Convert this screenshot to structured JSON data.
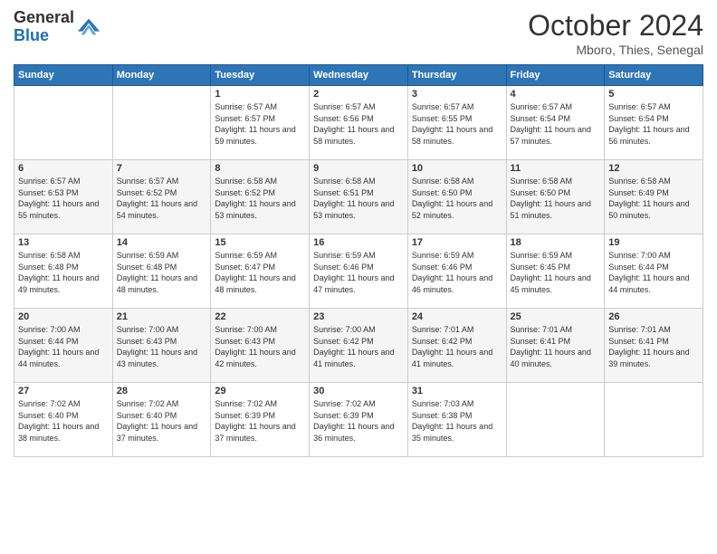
{
  "header": {
    "logo": {
      "line1": "General",
      "line2": "Blue"
    },
    "title": "October 2024",
    "subtitle": "Mboro, Thies, Senegal"
  },
  "days_of_week": [
    "Sunday",
    "Monday",
    "Tuesday",
    "Wednesday",
    "Thursday",
    "Friday",
    "Saturday"
  ],
  "weeks": [
    [
      {
        "day": "",
        "sunrise": "",
        "sunset": "",
        "daylight": ""
      },
      {
        "day": "",
        "sunrise": "",
        "sunset": "",
        "daylight": ""
      },
      {
        "day": "1",
        "sunrise": "Sunrise: 6:57 AM",
        "sunset": "Sunset: 6:57 PM",
        "daylight": "Daylight: 11 hours and 59 minutes."
      },
      {
        "day": "2",
        "sunrise": "Sunrise: 6:57 AM",
        "sunset": "Sunset: 6:56 PM",
        "daylight": "Daylight: 11 hours and 58 minutes."
      },
      {
        "day": "3",
        "sunrise": "Sunrise: 6:57 AM",
        "sunset": "Sunset: 6:55 PM",
        "daylight": "Daylight: 11 hours and 58 minutes."
      },
      {
        "day": "4",
        "sunrise": "Sunrise: 6:57 AM",
        "sunset": "Sunset: 6:54 PM",
        "daylight": "Daylight: 11 hours and 57 minutes."
      },
      {
        "day": "5",
        "sunrise": "Sunrise: 6:57 AM",
        "sunset": "Sunset: 6:54 PM",
        "daylight": "Daylight: 11 hours and 56 minutes."
      }
    ],
    [
      {
        "day": "6",
        "sunrise": "Sunrise: 6:57 AM",
        "sunset": "Sunset: 6:53 PM",
        "daylight": "Daylight: 11 hours and 55 minutes."
      },
      {
        "day": "7",
        "sunrise": "Sunrise: 6:57 AM",
        "sunset": "Sunset: 6:52 PM",
        "daylight": "Daylight: 11 hours and 54 minutes."
      },
      {
        "day": "8",
        "sunrise": "Sunrise: 6:58 AM",
        "sunset": "Sunset: 6:52 PM",
        "daylight": "Daylight: 11 hours and 53 minutes."
      },
      {
        "day": "9",
        "sunrise": "Sunrise: 6:58 AM",
        "sunset": "Sunset: 6:51 PM",
        "daylight": "Daylight: 11 hours and 53 minutes."
      },
      {
        "day": "10",
        "sunrise": "Sunrise: 6:58 AM",
        "sunset": "Sunset: 6:50 PM",
        "daylight": "Daylight: 11 hours and 52 minutes."
      },
      {
        "day": "11",
        "sunrise": "Sunrise: 6:58 AM",
        "sunset": "Sunset: 6:50 PM",
        "daylight": "Daylight: 11 hours and 51 minutes."
      },
      {
        "day": "12",
        "sunrise": "Sunrise: 6:58 AM",
        "sunset": "Sunset: 6:49 PM",
        "daylight": "Daylight: 11 hours and 50 minutes."
      }
    ],
    [
      {
        "day": "13",
        "sunrise": "Sunrise: 6:58 AM",
        "sunset": "Sunset: 6:48 PM",
        "daylight": "Daylight: 11 hours and 49 minutes."
      },
      {
        "day": "14",
        "sunrise": "Sunrise: 6:59 AM",
        "sunset": "Sunset: 6:48 PM",
        "daylight": "Daylight: 11 hours and 48 minutes."
      },
      {
        "day": "15",
        "sunrise": "Sunrise: 6:59 AM",
        "sunset": "Sunset: 6:47 PM",
        "daylight": "Daylight: 11 hours and 48 minutes."
      },
      {
        "day": "16",
        "sunrise": "Sunrise: 6:59 AM",
        "sunset": "Sunset: 6:46 PM",
        "daylight": "Daylight: 11 hours and 47 minutes."
      },
      {
        "day": "17",
        "sunrise": "Sunrise: 6:59 AM",
        "sunset": "Sunset: 6:46 PM",
        "daylight": "Daylight: 11 hours and 46 minutes."
      },
      {
        "day": "18",
        "sunrise": "Sunrise: 6:59 AM",
        "sunset": "Sunset: 6:45 PM",
        "daylight": "Daylight: 11 hours and 45 minutes."
      },
      {
        "day": "19",
        "sunrise": "Sunrise: 7:00 AM",
        "sunset": "Sunset: 6:44 PM",
        "daylight": "Daylight: 11 hours and 44 minutes."
      }
    ],
    [
      {
        "day": "20",
        "sunrise": "Sunrise: 7:00 AM",
        "sunset": "Sunset: 6:44 PM",
        "daylight": "Daylight: 11 hours and 44 minutes."
      },
      {
        "day": "21",
        "sunrise": "Sunrise: 7:00 AM",
        "sunset": "Sunset: 6:43 PM",
        "daylight": "Daylight: 11 hours and 43 minutes."
      },
      {
        "day": "22",
        "sunrise": "Sunrise: 7:00 AM",
        "sunset": "Sunset: 6:43 PM",
        "daylight": "Daylight: 11 hours and 42 minutes."
      },
      {
        "day": "23",
        "sunrise": "Sunrise: 7:00 AM",
        "sunset": "Sunset: 6:42 PM",
        "daylight": "Daylight: 11 hours and 41 minutes."
      },
      {
        "day": "24",
        "sunrise": "Sunrise: 7:01 AM",
        "sunset": "Sunset: 6:42 PM",
        "daylight": "Daylight: 11 hours and 41 minutes."
      },
      {
        "day": "25",
        "sunrise": "Sunrise: 7:01 AM",
        "sunset": "Sunset: 6:41 PM",
        "daylight": "Daylight: 11 hours and 40 minutes."
      },
      {
        "day": "26",
        "sunrise": "Sunrise: 7:01 AM",
        "sunset": "Sunset: 6:41 PM",
        "daylight": "Daylight: 11 hours and 39 minutes."
      }
    ],
    [
      {
        "day": "27",
        "sunrise": "Sunrise: 7:02 AM",
        "sunset": "Sunset: 6:40 PM",
        "daylight": "Daylight: 11 hours and 38 minutes."
      },
      {
        "day": "28",
        "sunrise": "Sunrise: 7:02 AM",
        "sunset": "Sunset: 6:40 PM",
        "daylight": "Daylight: 11 hours and 37 minutes."
      },
      {
        "day": "29",
        "sunrise": "Sunrise: 7:02 AM",
        "sunset": "Sunset: 6:39 PM",
        "daylight": "Daylight: 11 hours and 37 minutes."
      },
      {
        "day": "30",
        "sunrise": "Sunrise: 7:02 AM",
        "sunset": "Sunset: 6:39 PM",
        "daylight": "Daylight: 11 hours and 36 minutes."
      },
      {
        "day": "31",
        "sunrise": "Sunrise: 7:03 AM",
        "sunset": "Sunset: 6:38 PM",
        "daylight": "Daylight: 11 hours and 35 minutes."
      },
      {
        "day": "",
        "sunrise": "",
        "sunset": "",
        "daylight": ""
      },
      {
        "day": "",
        "sunrise": "",
        "sunset": "",
        "daylight": ""
      }
    ]
  ]
}
